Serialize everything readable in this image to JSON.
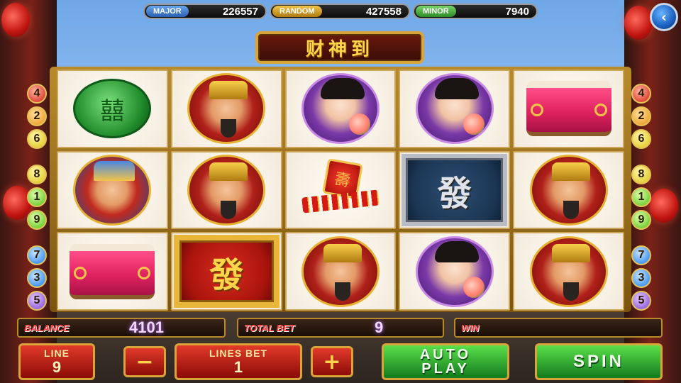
{
  "jackpots": {
    "major": {
      "label": "MAJOR",
      "value": "226557"
    },
    "random": {
      "label": "RANDOM",
      "value": "427558"
    },
    "minor": {
      "label": "MINOR",
      "value": "7940"
    }
  },
  "back_icon": "‹",
  "title": "财神到",
  "reels": [
    [
      "jade-medallion",
      "god-of-wealth-red",
      "girl-purple",
      "girl-purple",
      "drum"
    ],
    [
      "god-of-wealth-blue",
      "god-of-wealth-red",
      "firecracker",
      "fa-silver",
      "god-of-wealth-red"
    ],
    [
      "drum",
      "fa-gold",
      "god-of-wealth-red",
      "girl-purple",
      "god-of-wealth-red"
    ]
  ],
  "fa_glyph": "發",
  "lines_left": [
    "4",
    "2",
    "6",
    "8",
    "1",
    "9",
    "7",
    "3",
    "5"
  ],
  "lines_right": [
    "4",
    "2",
    "6",
    "8",
    "1",
    "9",
    "7",
    "3",
    "5"
  ],
  "info": {
    "balance_label": "BALANCE",
    "balance_value": "4101",
    "total_bet_label": "TOTAL BET",
    "total_bet_value": "9",
    "win_label": "WIN",
    "win_value": ""
  },
  "controls": {
    "line_label": "LINE",
    "line_value": "9",
    "minus": "−",
    "lines_bet_label": "LINES BET",
    "lines_bet_value": "1",
    "plus": "+",
    "auto_label_1": "AUTO",
    "auto_label_2": "PLAY",
    "spin_label": "SPIN"
  }
}
